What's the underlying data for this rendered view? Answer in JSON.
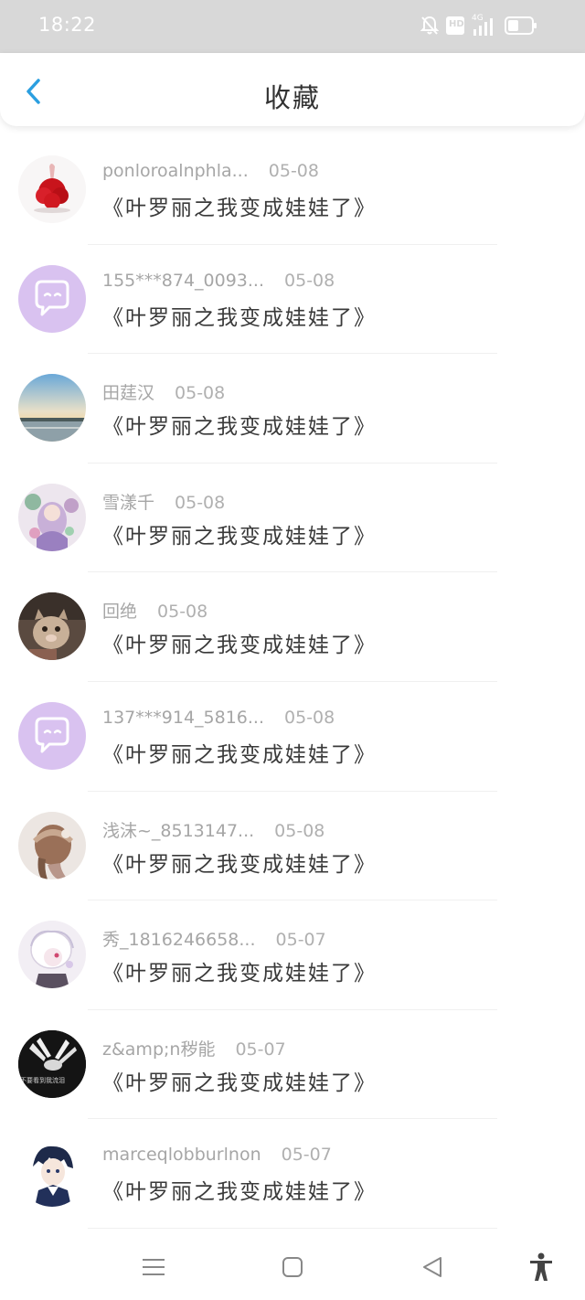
{
  "status_bar": {
    "time": "18:22",
    "hd_label": "HD",
    "network_label": "4G",
    "icons": [
      "bell-muted-icon",
      "hd-icon",
      "signal-icon",
      "battery-icon"
    ]
  },
  "header": {
    "title": "收藏",
    "back_icon": "chevron-left-icon"
  },
  "colors": {
    "accent": "#2b9fe0",
    "status_bar": "#d8d8d8",
    "avatar_default": "#d9c2f0"
  },
  "items": [
    {
      "name": "ponloroalnphla...",
      "date": "05-08",
      "title": "《叶罗丽之我变成娃娃了》",
      "avatar": "red-flower-avatar"
    },
    {
      "name": "155***874_0093...",
      "date": "05-08",
      "title": "《叶罗丽之我变成娃娃了》",
      "avatar": "default-chat-avatar"
    },
    {
      "name": "田莛汉",
      "date": "05-08",
      "title": "《叶罗丽之我变成娃娃了》",
      "avatar": "landscape-avatar"
    },
    {
      "name": "雪漾千",
      "date": "05-08",
      "title": "《叶罗丽之我变成娃娃了》",
      "avatar": "anime-girl-avatar"
    },
    {
      "name": "回绝",
      "date": "05-08",
      "title": "《叶罗丽之我变成娃娃了》",
      "avatar": "cat-avatar"
    },
    {
      "name": "137***914_5816...",
      "date": "05-08",
      "title": "《叶罗丽之我变成娃娃了》",
      "avatar": "default-chat-avatar"
    },
    {
      "name": "浅沫~_8513147...",
      "date": "05-08",
      "title": "《叶罗丽之我变成娃娃了》",
      "avatar": "girl-back-avatar"
    },
    {
      "name": "秀_1816246658...",
      "date": "05-07",
      "title": "《叶罗丽之我变成娃娃了》",
      "avatar": "white-hair-avatar"
    },
    {
      "name": "z&amp;n秽能",
      "date": "05-07",
      "title": "《叶罗丽之我变成娃娃了》",
      "avatar": "dark-hands-avatar",
      "avatar_text": "不要看到我流泪"
    },
    {
      "name": "marceqlobburlnon",
      "date": "05-07",
      "title": "《叶罗丽之我变成娃娃了》",
      "avatar": "anime-boy-avatar"
    }
  ],
  "navbar": {
    "icons": [
      "menu-icon",
      "home-icon",
      "back-icon",
      "accessibility-icon"
    ]
  }
}
